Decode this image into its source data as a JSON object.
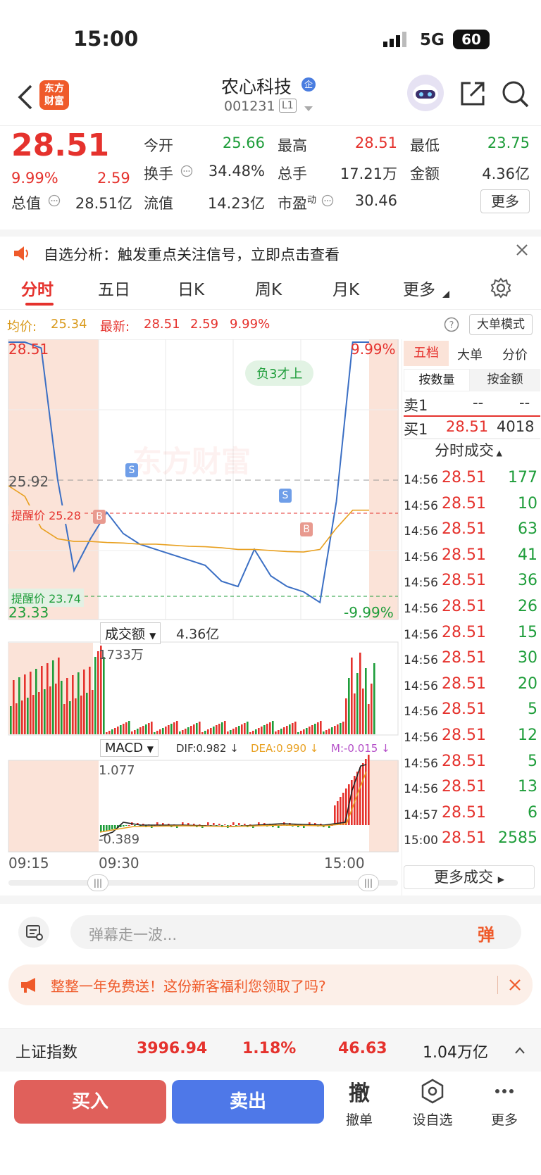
{
  "status": {
    "time": "15:00",
    "network": "5G",
    "battery": "60"
  },
  "header": {
    "stock_name": "农心科技",
    "name_badge": "企",
    "stock_code": "001231",
    "level_badge": "L1",
    "logo_text_line1": "东方",
    "logo_text_line2": "财富"
  },
  "quote": {
    "price": "28.51",
    "change_pct": "9.99%",
    "change_amt": "2.59",
    "open_label": "今开",
    "open": "25.66",
    "high_label": "最高",
    "high": "28.51",
    "low_label": "最低",
    "low": "23.75",
    "turnover_label": "换手",
    "turnover": "34.48%",
    "total_vol_label": "总手",
    "total_vol": "17.21万",
    "amount_label": "金额",
    "amount": "4.36亿",
    "total_cap_label": "总值",
    "total_cap": "28.51亿",
    "float_cap_label": "流值",
    "float_cap": "14.23亿",
    "pe_label": "市盈",
    "pe_sup": "动",
    "pe": "30.46",
    "more_button": "更多"
  },
  "notice": {
    "text": "自选分析：触发重点关注信号，立即点击查看"
  },
  "tabs": [
    "分时",
    "五日",
    "日K",
    "周K",
    "月K",
    "更多"
  ],
  "avg_line": {
    "avg_label": "均价:",
    "avg_value": "25.34",
    "latest_label": "最新:",
    "latest_price": "28.51",
    "latest_change": "2.59",
    "latest_pct": "9.99%",
    "big_order_button": "大单模式"
  },
  "chart": {
    "price_top_left": "28.51",
    "pct_top_right": "9.99%",
    "mid_price": "25.92",
    "price_bottom_left": "23.33",
    "pct_bottom_right": "-9.99%",
    "remind_high_label": "提醒价 25.28",
    "remind_low_label": "提醒价 23.74",
    "bubble": "负3才上",
    "watermark": "东方财富",
    "vol_selector": "成交额",
    "vol_total": "4.36亿",
    "vol_max": "1733万",
    "macd_selector": "MACD",
    "dif": "DIF:0.982 ↓",
    "dea": "DEA:0.990 ↓",
    "m": "M:-0.015 ↓",
    "macd_max": "1.077",
    "macd_min": "-0.389",
    "time_start": "09:15",
    "time_open": "09:30",
    "time_end": "15:00",
    "marker_s": "S",
    "marker_b": "B",
    "colors": {
      "up": "#e5322d",
      "down": "#1e9d3a",
      "price_line": "#3b6fc4",
      "avg_line": "#e8a020"
    }
  },
  "chart_data": {
    "type": "line",
    "title": "",
    "ylim": [
      23.33,
      28.51
    ],
    "series": [
      {
        "values": [
          28.51,
          28.51,
          28.4,
          25.92,
          24.2,
          24.8,
          25.3,
          24.9,
          24.7,
          24.6,
          24.5,
          24.4,
          24.3,
          24.0,
          23.9,
          24.6,
          24.1,
          23.9,
          23.8,
          23.6,
          25.5,
          28.51,
          28.51
        ]
      },
      {
        "values": [
          25.8,
          25.6,
          25.0,
          24.8,
          24.75,
          24.75,
          24.73,
          24.72,
          24.7,
          24.7,
          24.68,
          24.66,
          24.65,
          24.63,
          24.6,
          24.6,
          24.58,
          24.56,
          24.55,
          24.6,
          25.0,
          25.34,
          25.34
        ]
      }
    ]
  },
  "right_panel": {
    "tabs": [
      "五档",
      "大单",
      "分价"
    ],
    "subtabs": [
      "按数量",
      "按金额"
    ],
    "sell1_label": "卖1",
    "sell1_price": "--",
    "sell1_vol": "--",
    "buy1_label": "买1",
    "buy1_price": "28.51",
    "buy1_vol": "4018",
    "trades_title": "分时成交",
    "trades": [
      {
        "t": "14:56",
        "p": "28.51",
        "v": "177"
      },
      {
        "t": "14:56",
        "p": "28.51",
        "v": "10"
      },
      {
        "t": "14:56",
        "p": "28.51",
        "v": "63"
      },
      {
        "t": "14:56",
        "p": "28.51",
        "v": "41"
      },
      {
        "t": "14:56",
        "p": "28.51",
        "v": "36"
      },
      {
        "t": "14:56",
        "p": "28.51",
        "v": "26"
      },
      {
        "t": "14:56",
        "p": "28.51",
        "v": "15"
      },
      {
        "t": "14:56",
        "p": "28.51",
        "v": "30"
      },
      {
        "t": "14:56",
        "p": "28.51",
        "v": "20"
      },
      {
        "t": "14:56",
        "p": "28.51",
        "v": "5"
      },
      {
        "t": "14:56",
        "p": "28.51",
        "v": "12"
      },
      {
        "t": "14:56",
        "p": "28.51",
        "v": "5"
      },
      {
        "t": "14:56",
        "p": "28.51",
        "v": "13"
      },
      {
        "t": "14:57",
        "p": "28.51",
        "v": "6"
      },
      {
        "t": "15:00",
        "p": "28.51",
        "v": "2585"
      }
    ],
    "more_trades": "更多成交"
  },
  "danmaku": {
    "placeholder": "弹幕走一波...",
    "send_label": "弹"
  },
  "promo": {
    "text": "整整一年免费送！这份新客福利您领取了吗?"
  },
  "index_bar": {
    "name": "上证指数",
    "value": "3996.94",
    "pct": "1.18%",
    "change": "46.63",
    "amount": "1.04万亿"
  },
  "bottom": {
    "buy": "买入",
    "sell": "卖出",
    "cancel_icon": "撤",
    "cancel": "撤单",
    "watch": "设自选",
    "more": "更多"
  }
}
